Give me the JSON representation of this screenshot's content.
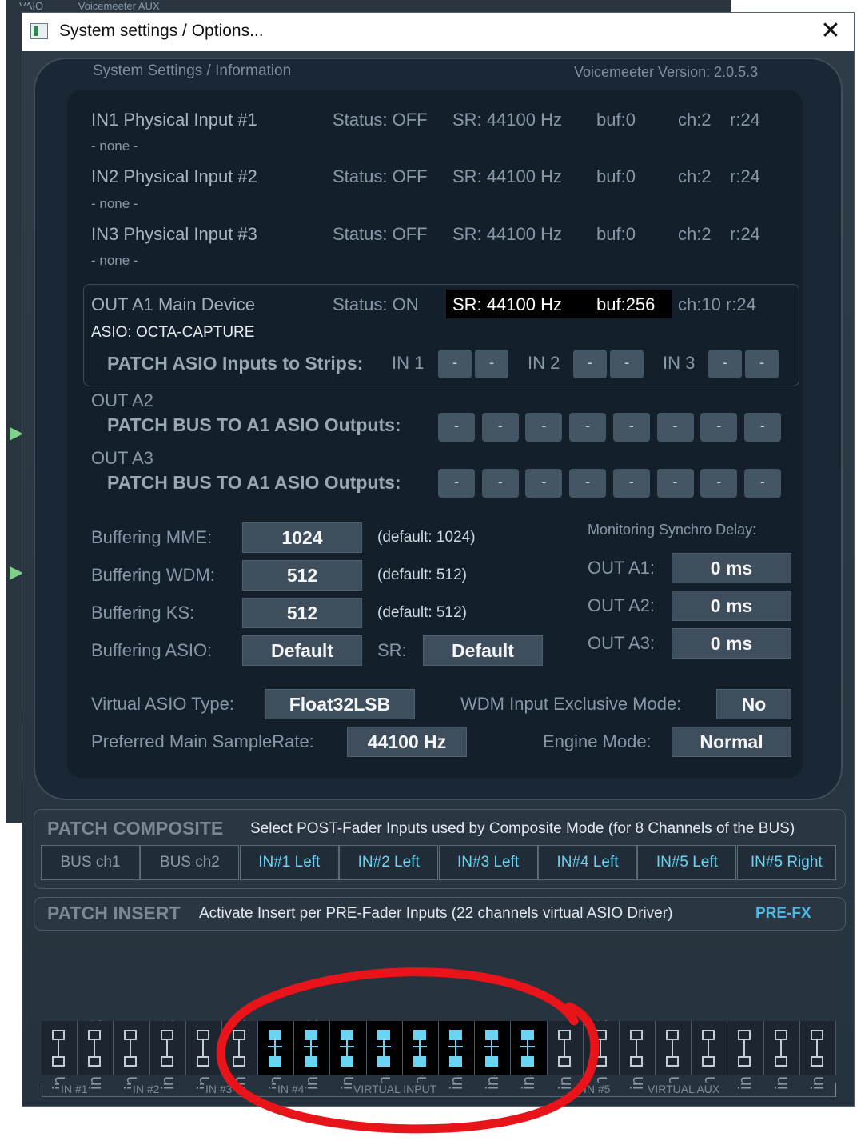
{
  "background": {
    "top_text": [
      "VAIO",
      "Voicemeeter AUX"
    ]
  },
  "window": {
    "title": "System settings / Options...",
    "close_glyph": "✕"
  },
  "header": {
    "left": "System Settings / Information",
    "right": "Voicemeeter Version: 2.0.5.3"
  },
  "inputs": [
    {
      "name": "IN1 Physical Input #1",
      "device": "- none -",
      "status": "Status: OFF",
      "sr": "SR: 44100 Hz",
      "buf": "buf:0",
      "ch": "ch:2",
      "r": "r:24"
    },
    {
      "name": "IN2 Physical Input #2",
      "device": "- none -",
      "status": "Status: OFF",
      "sr": "SR: 44100 Hz",
      "buf": "buf:0",
      "ch": "ch:2",
      "r": "r:24"
    },
    {
      "name": "IN3 Physical Input #3",
      "device": "- none -",
      "status": "Status: OFF",
      "sr": "SR: 44100 Hz",
      "buf": "buf:0",
      "ch": "ch:2",
      "r": "r:24"
    }
  ],
  "out_a1": {
    "name": "OUT A1 Main Device",
    "status": "Status: ON",
    "sr": "SR: 44100 Hz",
    "buf": "buf:256",
    "ch": "ch:10 r:24",
    "device": "ASIO: OCTA-CAPTURE",
    "patch_label": "PATCH ASIO Inputs to Strips:",
    "in_labels": [
      "IN 1",
      "IN 2",
      "IN 3"
    ],
    "btn": "-"
  },
  "out_a2": {
    "name": "OUT A2",
    "patch_label": "PATCH BUS TO A1 ASIO Outputs:",
    "btn": "-"
  },
  "out_a3": {
    "name": "OUT A3",
    "patch_label": "PATCH BUS TO A1 ASIO Outputs:",
    "btn": "-"
  },
  "buffering": {
    "mme": {
      "label": "Buffering MME:",
      "value": "1024",
      "default": "(default: 1024)"
    },
    "wdm": {
      "label": "Buffering WDM:",
      "value": "512",
      "default": "(default: 512)"
    },
    "ks": {
      "label": "Buffering KS:",
      "value": "512",
      "default": "(default: 512)"
    },
    "asio": {
      "label": "Buffering ASIO:",
      "value": "Default",
      "sr_label": "SR:",
      "sr_value": "Default"
    }
  },
  "monitoring": {
    "title": "Monitoring Synchro Delay:",
    "rows": [
      {
        "label": "OUT A1:",
        "value": "0 ms"
      },
      {
        "label": "OUT A2:",
        "value": "0 ms"
      },
      {
        "label": "OUT A3:",
        "value": "0 ms"
      }
    ]
  },
  "virtual_asio": {
    "label": "Virtual ASIO Type:",
    "value": "Float32LSB"
  },
  "wdm_exclusive": {
    "label": "WDM Input Exclusive Mode:",
    "value": "No"
  },
  "samplerate": {
    "label": "Preferred Main SampleRate:",
    "value": "44100 Hz"
  },
  "engine": {
    "label": "Engine Mode:",
    "value": "Normal"
  },
  "patch_composite": {
    "title": "PATCH COMPOSITE",
    "desc": "Select POST-Fader Inputs used by Composite Mode (for 8 Channels of the BUS)",
    "buttons": [
      {
        "label": "BUS ch1",
        "active": false
      },
      {
        "label": "BUS ch2",
        "active": false
      },
      {
        "label": "IN#1 Left",
        "active": true
      },
      {
        "label": "IN#2 Left",
        "active": true
      },
      {
        "label": "IN#3 Left",
        "active": true
      },
      {
        "label": "IN#4 Left",
        "active": true
      },
      {
        "label": "IN#5 Left",
        "active": true
      },
      {
        "label": "IN#5 Right",
        "active": true
      }
    ]
  },
  "patch_insert": {
    "title": "PATCH INSERT",
    "desc": "Activate Insert per PRE-Fader Inputs (22 channels virtual ASIO Driver)",
    "prefx": "PRE-FX",
    "channels": [
      {
        "label": "in1 Left",
        "active": false
      },
      {
        "label": "in1 Right",
        "active": false
      },
      {
        "label": "in2 Left",
        "active": false
      },
      {
        "label": "in2 Right",
        "active": false
      },
      {
        "label": "in3 Left",
        "active": false
      },
      {
        "label": "in3 Right",
        "active": false
      },
      {
        "label": "in4 Left",
        "active": true
      },
      {
        "label": "in4 Right",
        "active": true
      },
      {
        "label": "in4 C",
        "active": true
      },
      {
        "label": "in4 LFE",
        "active": true
      },
      {
        "label": "in4 SL",
        "active": true
      },
      {
        "label": "in4 SR",
        "active": true
      },
      {
        "label": "in4 BL",
        "active": true
      },
      {
        "label": "in4 BR",
        "active": true
      },
      {
        "label": "in5 Left",
        "active": false
      },
      {
        "label": "in5 Right",
        "active": false
      },
      {
        "label": "in5 C",
        "active": false
      },
      {
        "label": "in5 LFE",
        "active": false
      },
      {
        "label": "in5 SL",
        "active": false
      },
      {
        "label": "in5 SR",
        "active": false
      },
      {
        "label": "in5 BL",
        "active": false
      },
      {
        "label": "in5 BR",
        "active": false
      }
    ],
    "groups": [
      "IN #1",
      "IN #2",
      "IN #3",
      "IN #4",
      "VIRTUAL INPUT",
      "IN #5",
      "VIRTUAL AUX"
    ]
  },
  "colors": {
    "accent": "#6ad4f2",
    "annotation": "#e8141a",
    "bg": "#1a2734"
  }
}
